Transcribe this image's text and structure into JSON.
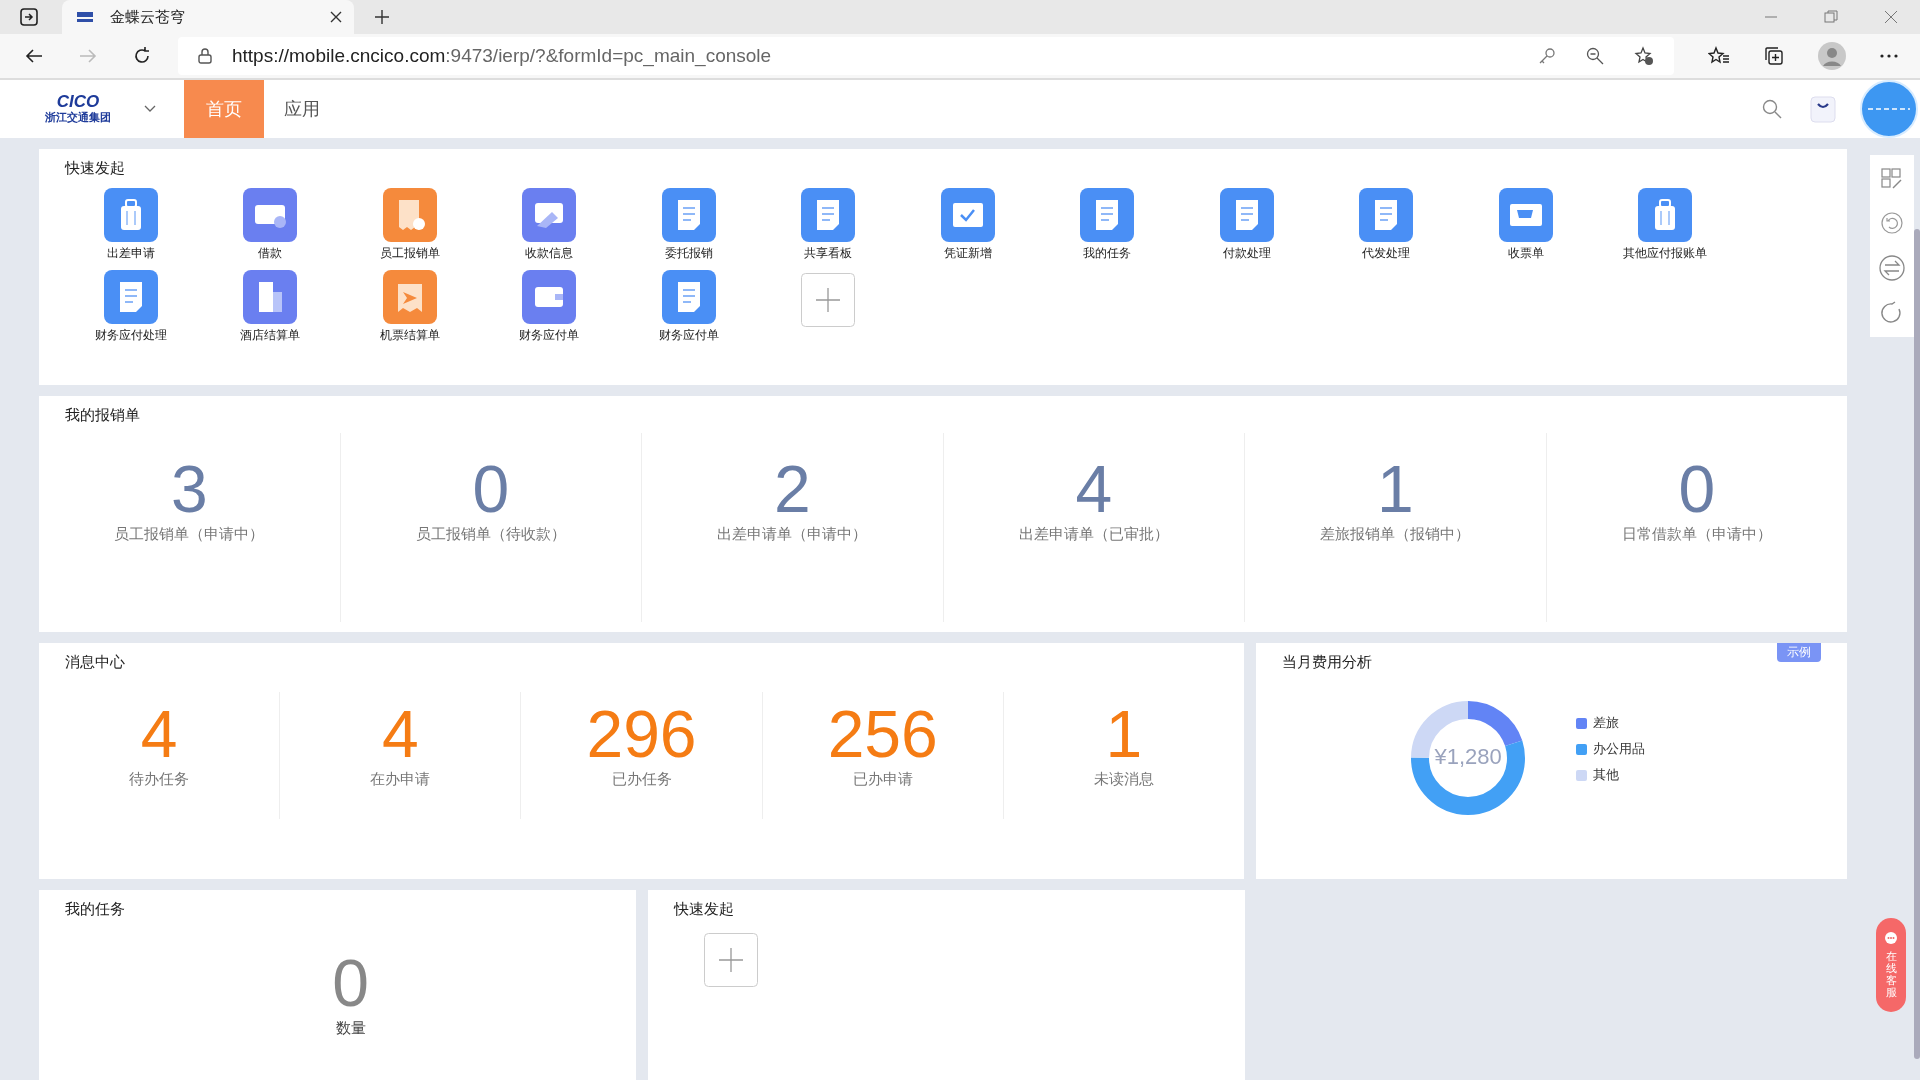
{
  "browser": {
    "tab_title": "金蝶云苍穹",
    "url_host": "https://mobile.cncico.com",
    "url_rest": ":9473/ierp/?&formId=pc_main_console"
  },
  "header": {
    "logo_text": "CICO",
    "logo_sub": "浙江交通集团",
    "nav": [
      {
        "label": "首页",
        "selected": true
      },
      {
        "label": "应用",
        "selected": false
      }
    ]
  },
  "quick_launch": {
    "title": "快速发起",
    "items": [
      {
        "label": "出差申请",
        "kind": "suitcase",
        "color": "#4a8ff5"
      },
      {
        "label": "借款",
        "kind": "money",
        "color": "#6a7ff0"
      },
      {
        "label": "员工报销单",
        "kind": "receipt",
        "color": "#f58a3c"
      },
      {
        "label": "收款信息",
        "kind": "card",
        "color": "#6a7ff0"
      },
      {
        "label": "委托报销",
        "kind": "document",
        "color": "#4a8ff5"
      },
      {
        "label": "共享看板",
        "kind": "document",
        "color": "#4a8ff5"
      },
      {
        "label": "凭证新增",
        "kind": "voucher",
        "color": "#4a8ff5"
      },
      {
        "label": "我的任务",
        "kind": "document",
        "color": "#4a8ff5"
      },
      {
        "label": "付款处理",
        "kind": "document",
        "color": "#4a8ff5"
      },
      {
        "label": "代发处理",
        "kind": "document",
        "color": "#4a8ff5"
      },
      {
        "label": "收票单",
        "kind": "cart",
        "color": "#4a8ff5"
      },
      {
        "label": "其他应付报账单",
        "kind": "suitcase",
        "color": "#4a8ff5"
      },
      {
        "label": "财务应付处理",
        "kind": "document",
        "color": "#4a8ff5"
      },
      {
        "label": "酒店结算单",
        "kind": "building",
        "color": "#6a7ff0"
      },
      {
        "label": "机票结算单",
        "kind": "plane",
        "color": "#f58a3c"
      },
      {
        "label": "财务应付单",
        "kind": "wallet",
        "color": "#6a7ff0"
      },
      {
        "label": "财务应付单",
        "kind": "document",
        "color": "#4a8ff5"
      }
    ]
  },
  "my_reimbursements": {
    "title": "我的报销单",
    "stats": [
      {
        "value": "3",
        "label": "员工报销单（申请中）"
      },
      {
        "value": "0",
        "label": "员工报销单（待收款）"
      },
      {
        "value": "2",
        "label": "出差申请单（申请中）"
      },
      {
        "value": "4",
        "label": "出差申请单（已审批）"
      },
      {
        "value": "1",
        "label": "差旅报销单（报销中）"
      },
      {
        "value": "0",
        "label": "日常借款单（申请中）"
      }
    ]
  },
  "message_center": {
    "title": "消息中心",
    "stats": [
      {
        "value": "4",
        "label": "待办任务"
      },
      {
        "value": "4",
        "label": "在办申请"
      },
      {
        "value": "296",
        "label": "已办任务"
      },
      {
        "value": "256",
        "label": "已办申请"
      },
      {
        "value": "1",
        "label": "未读消息"
      }
    ]
  },
  "expense_analysis": {
    "title": "当月费用分析",
    "badge": "示例",
    "total": "¥1,280",
    "legend": [
      {
        "label": "差旅",
        "color": "#6284f5"
      },
      {
        "label": "办公用品",
        "color": "#42a0f5"
      },
      {
        "label": "其他",
        "color": "#cdd8f5"
      }
    ]
  },
  "my_tasks": {
    "title": "我的任务",
    "value": "0",
    "label": "数量"
  },
  "quick_launch_2": {
    "title": "快速发起"
  },
  "online_service": {
    "label": "在线客服"
  }
}
